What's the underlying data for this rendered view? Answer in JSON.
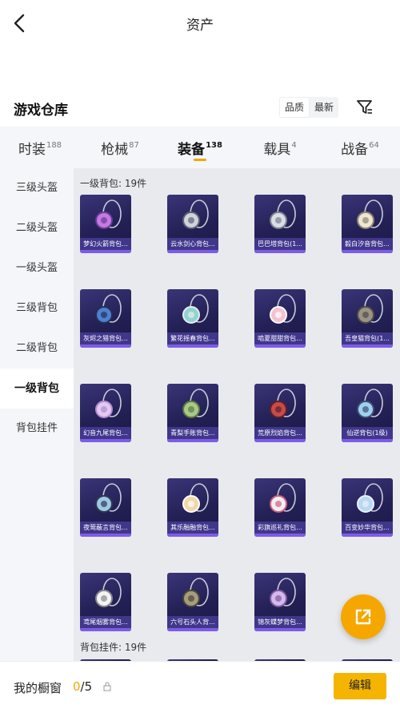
{
  "header": {
    "title": "资产"
  },
  "warehouse": {
    "title": "游戏仓库",
    "sort_options": [
      "品质",
      "最新"
    ],
    "active_sort": 0
  },
  "tabs": [
    {
      "label": "时装",
      "count": "188"
    },
    {
      "label": "枪械",
      "count": "87"
    },
    {
      "label": "装备",
      "count": "138",
      "active": true
    },
    {
      "label": "载具",
      "count": "4"
    },
    {
      "label": "战备",
      "count": "64"
    }
  ],
  "sidebar": {
    "items": [
      "三级头盔",
      "二级头盔",
      "一级头盔",
      "三级背包",
      "二级背包",
      "一级背包",
      "背包挂件"
    ],
    "active_index": 5
  },
  "sections": [
    {
      "label": "一级背包: 19件",
      "items": [
        {
          "name": "梦幻火箭背包...",
          "art": "pink-rocket"
        },
        {
          "name": "云水剑心背包...",
          "art": "sword"
        },
        {
          "name": "巴巴塔背包(1...",
          "art": "orb-silver"
        },
        {
          "name": "毅白汐音背包...",
          "art": "orb-cream"
        },
        {
          "name": "灰烬之猎背包...",
          "art": "orb-blue"
        },
        {
          "name": "繁花摇春背包...",
          "art": "bunny-teal"
        },
        {
          "name": "啮夏甜甜背包...",
          "art": "bunny-pink"
        },
        {
          "name": "吾皇猫背包(1...",
          "art": "cat-gray"
        },
        {
          "name": "幻音九尾背包...",
          "art": "crystal"
        },
        {
          "name": "青梨手账背包...",
          "art": "pear"
        },
        {
          "name": "荒原烈焰背包...",
          "art": "flame-mask"
        },
        {
          "name": "仙逆背包(1级)",
          "art": "diamond-pendant"
        },
        {
          "name": "夜莺蔽言背包...",
          "art": "bird"
        },
        {
          "name": "其乐融融背包...",
          "art": "bunny-cream"
        },
        {
          "name": "彩旗巡礼背包...",
          "art": "bunny-white"
        },
        {
          "name": "百变妙华背包...",
          "art": "flower-blue"
        },
        {
          "name": "鸢尾烟雾背包...",
          "art": "card"
        },
        {
          "name": "六号石头人背...",
          "art": "golem"
        },
        {
          "name": "锦灰蝶梦背包...",
          "art": "gem-purple"
        }
      ]
    },
    {
      "label": "背包挂件: 19件"
    }
  ],
  "bottom": {
    "label": "我的橱窗",
    "count_current": "0",
    "count_total": "/5",
    "edit_label": "编辑"
  },
  "colors": {
    "accent": "#f5a700",
    "card_bg": "#232055",
    "card_label_bg": "#463c96",
    "card_bar": "#7d5ce6",
    "tab_bar_bg": "#f4f6f9",
    "content_bg": "#e8eaee"
  }
}
